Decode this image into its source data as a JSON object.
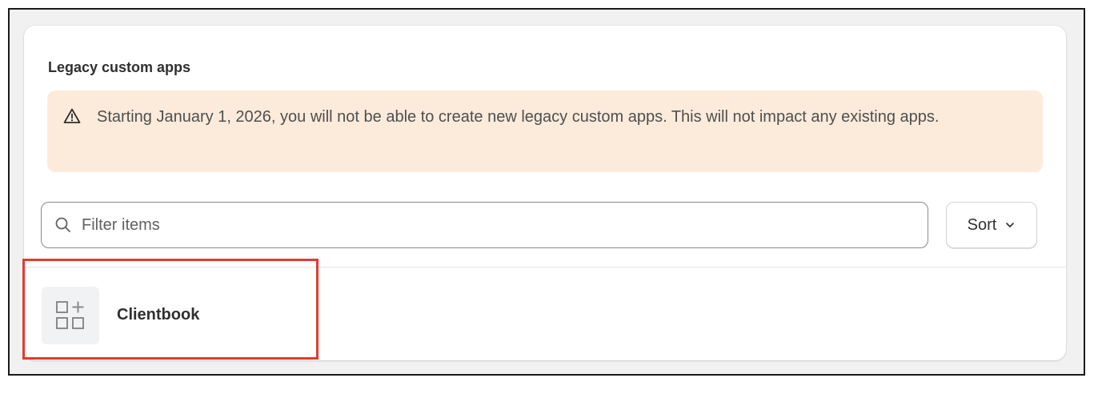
{
  "section": {
    "title": "Legacy custom apps"
  },
  "banner": {
    "icon": "warning-triangle-icon",
    "text": "Starting January 1, 2026, you will not be able to create new legacy custom apps. This will not impact any existing apps.",
    "background": "#fcebdb"
  },
  "filter": {
    "placeholder": "Filter items",
    "value": "",
    "icon": "search-icon"
  },
  "sort": {
    "label": "Sort",
    "icon": "chevron-down-icon"
  },
  "apps": [
    {
      "name": "Clientbook",
      "icon": "app-grid-plus-icon"
    }
  ],
  "colors": {
    "highlight": "#e53a2e",
    "text": "#303030"
  }
}
